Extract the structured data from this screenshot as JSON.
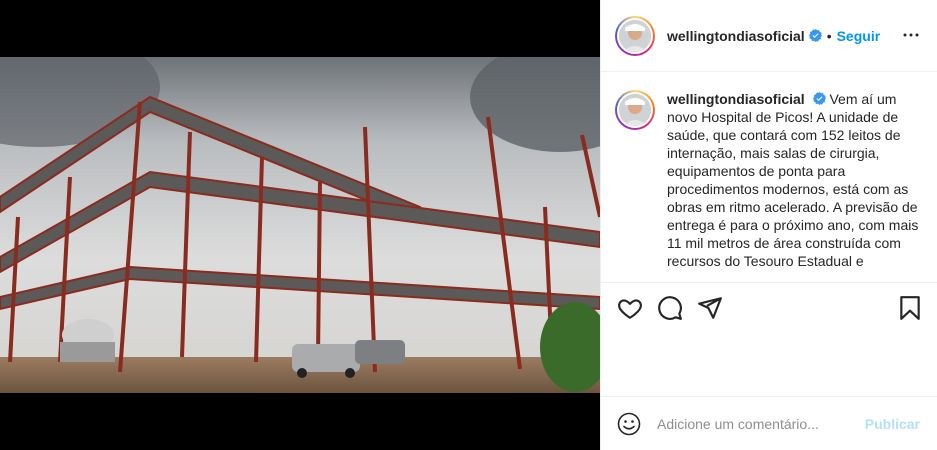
{
  "post": {
    "username": "wellingtondiasoficial",
    "verified": true,
    "follow_label": "Seguir",
    "separator": "•",
    "caption_text": "Vem aí um novo Hospital de Picos! A unidade de saúde, que contará com 152 leitos de internação, mais salas de cirurgia, equipamentos de ponta para procedimentos modernos, está com as obras em ritmo acelerado. A previsão de entrega é para o próximo ano, com mais 11 mil metros de área construída com recursos do Tesouro Estadual e"
  },
  "actions": {
    "icons": [
      "heart-icon",
      "comment-icon",
      "share-icon",
      "bookmark-icon"
    ]
  },
  "comment": {
    "placeholder": "Adicione um comentário...",
    "publish_label": "Publicar"
  },
  "colors": {
    "accent": "#0095f6",
    "publish_disabled": "#b2dffc",
    "border": "#efefef",
    "text": "#262626",
    "muted": "#8e8e8e"
  }
}
